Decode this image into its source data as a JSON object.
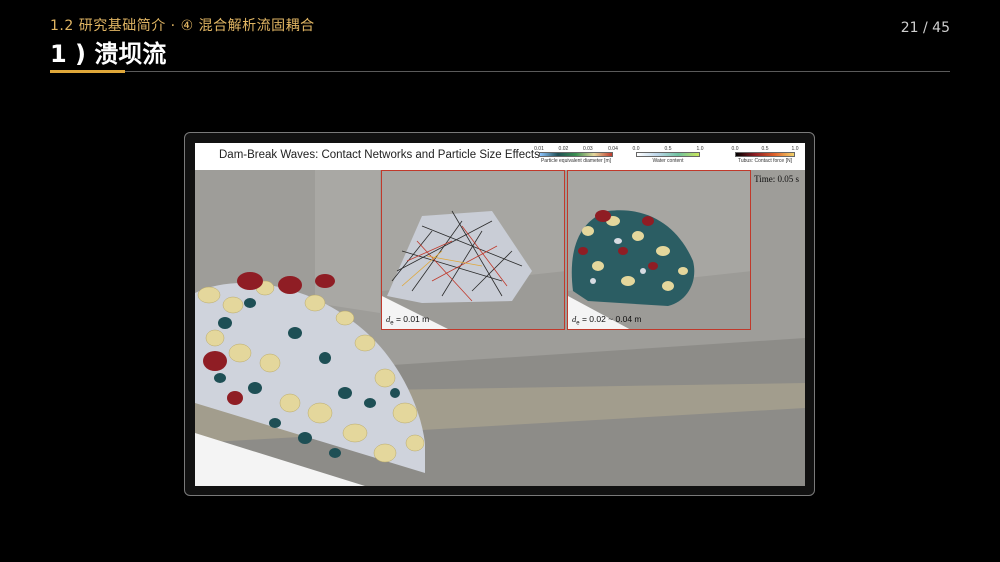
{
  "slide": {
    "subtitle": "1.2 研究基础简介 · ④ 混合解析流固耦合",
    "title": "1 ) 溃坝流",
    "page": "21 / 45"
  },
  "figure": {
    "title": "Dam-Break Waves: Contact Networks and Particle Size Effects",
    "time": "Time: 0.05 s",
    "colorbars": [
      {
        "label": "Particle equivalent diameter [m]",
        "ticks": [
          "0.01",
          "0.02",
          "0.03",
          "0.04"
        ]
      },
      {
        "label": "Water content",
        "ticks": [
          "0.0",
          "0.5",
          "1.0"
        ]
      },
      {
        "label": "Tubus: Contact force [N]",
        "ticks": [
          "0.0",
          "0.5",
          "1.0"
        ]
      }
    ],
    "insets": [
      {
        "label_var": "d",
        "label_sub": "e",
        "label_value": " = 0.01 m"
      },
      {
        "label_var": "d",
        "label_sub": "e",
        "label_value": " = 0.02 ~ 0.04 m"
      }
    ]
  }
}
